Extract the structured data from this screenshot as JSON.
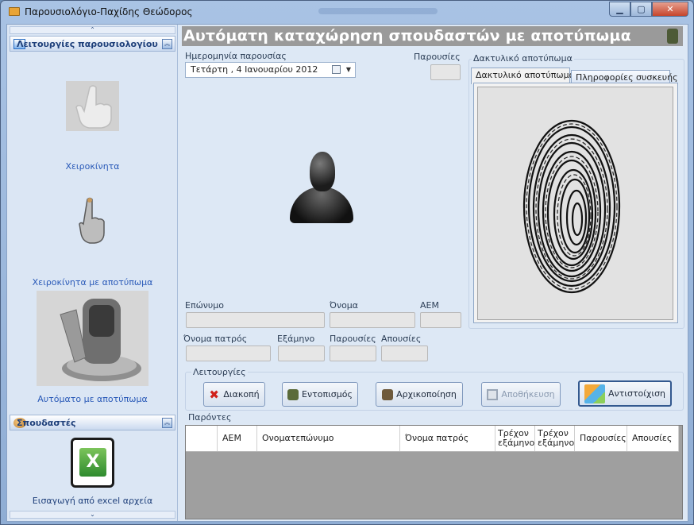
{
  "window": {
    "title": "Παρουσιολόγιο-Παχίδης Θεώδορος",
    "buttons": {
      "minimize": "▁",
      "maximize": "▢",
      "close": "✕"
    }
  },
  "sidebar": {
    "scroll_up": "⌃",
    "scroll_down": "⌄",
    "section_attendance": {
      "label": "Λειτουργίες παρουσιολογίου",
      "items": [
        {
          "label": "Χειροκίνητα",
          "icon": "hand-pointer-icon"
        },
        {
          "label": "Χειροκίνητα με αποτύπωμα",
          "icon": "hand-finger-icon"
        },
        {
          "label": "Αυτόματο με αποτύπωμα",
          "icon": "fingerprint-scanner-icon"
        }
      ]
    },
    "section_students": {
      "label": "Σπουδαστές",
      "items": [
        {
          "label": "Εισαγωγή από excel αρχεία",
          "icon": "excel-icon"
        }
      ]
    }
  },
  "main": {
    "header_title": "Αυτόματη καταχώρηση σπουδαστών με αποτύπωμα",
    "date_label": "Ημερομηνία παρουσίας",
    "date_value": "Τετάρτη  ,  4  Ιανουαρίου  2012",
    "presences_label": "Παρουσίες",
    "fields": {
      "surname": "Επώνυμο",
      "name": "Όνομα",
      "aem": "ΑΕΜ",
      "father_name": "Όνομα πατρός",
      "semester": "Εξάμηνο",
      "presences": "Παρουσίες",
      "absences": "Απουσίες"
    },
    "fingerprint": {
      "group_title": "Δακτυλικό αποτύπωμα",
      "tabs": [
        "Δακτυλικό αποτύπωμα",
        "Πληροφορίες συσκευής"
      ]
    },
    "operations": {
      "title": "Λειτουργίες",
      "buttons": [
        {
          "label": "Διακοπή",
          "icon": "stop-x-icon"
        },
        {
          "label": "Εντοπισμός",
          "icon": "scanner-search-icon"
        },
        {
          "label": "Αρχικοποίηση",
          "icon": "scanner-init-icon"
        },
        {
          "label": "Αποθήκευση",
          "icon": "save-disk-icon"
        },
        {
          "label": "Αντιστοίχιση",
          "icon": "boxes-icon"
        }
      ]
    },
    "present": {
      "title": "Παρόντες",
      "columns": [
        "ΑΕΜ",
        "Ονοματεπώνυμο",
        "Όνομα πατρός",
        "Τρέχον εξάμηνο",
        "Τρέχον εξάμηνο",
        "Παρουσίες",
        "Απουσίες"
      ],
      "rows": []
    }
  },
  "colors": {
    "header_bg": "#9a9a9a",
    "link_blue": "#2a5ab8",
    "frame_blue": "#a9c3e4"
  }
}
